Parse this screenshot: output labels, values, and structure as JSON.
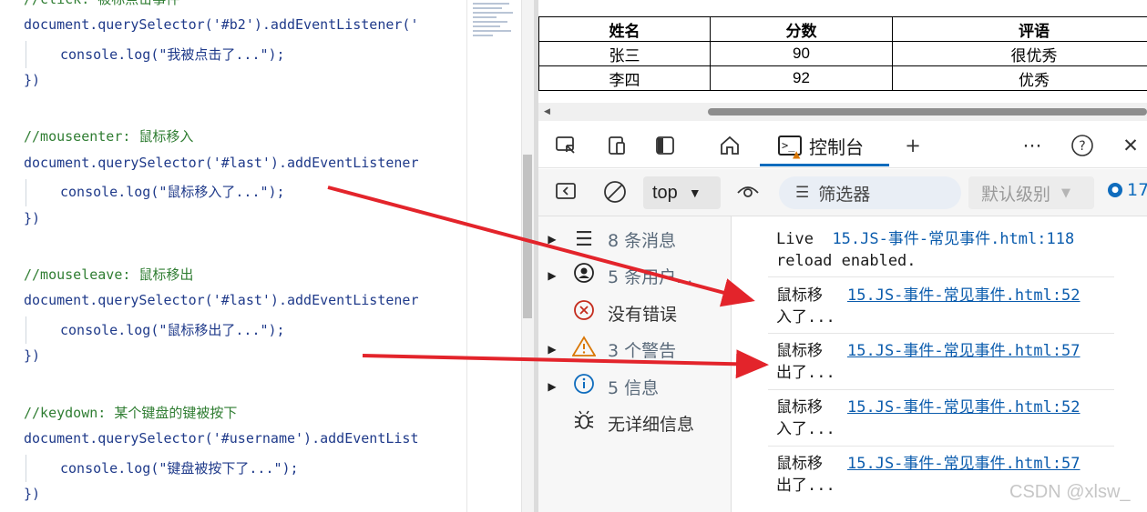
{
  "editor": {
    "lines": [
      {
        "text": "//click: 被标点击事件",
        "kind": "comment"
      },
      {
        "text": "document.querySelector('#b2').addEventListener('",
        "kind": "code"
      },
      {
        "text": "console.log(\"我被点击了...\");",
        "kind": "indent"
      },
      {
        "text": "})",
        "kind": "brace"
      },
      {
        "text": "//mouseenter: 鼠标移入",
        "kind": "comment"
      },
      {
        "text": "document.querySelector('#last').addEventListener",
        "kind": "code"
      },
      {
        "text": "console.log(\"鼠标移入了...\");",
        "kind": "indent"
      },
      {
        "text": "})",
        "kind": "brace"
      },
      {
        "text": "//mouseleave: 鼠标移出",
        "kind": "comment"
      },
      {
        "text": "document.querySelector('#last').addEventListener",
        "kind": "code"
      },
      {
        "text": "console.log(\"鼠标移出了...\");",
        "kind": "indent"
      },
      {
        "text": "})",
        "kind": "brace"
      },
      {
        "text": "//keydown: 某个键盘的键被按下",
        "kind": "comment"
      },
      {
        "text": "document.querySelector('#username').addEventList",
        "kind": "code"
      },
      {
        "text": "console.log(\"键盘被按下了...\");",
        "kind": "indent"
      },
      {
        "text": "})",
        "kind": "brace"
      }
    ]
  },
  "table": {
    "headers": [
      "姓名",
      "分数",
      "评语"
    ],
    "rows": [
      [
        "张三",
        "90",
        "很优秀"
      ],
      [
        "李四",
        "92",
        "优秀"
      ]
    ]
  },
  "devtools": {
    "console_tab": "控制台",
    "context": "top",
    "filter_placeholder": "筛选器",
    "level": "默认级别",
    "issue_count": "17",
    "sidebar": [
      {
        "label": "8 条消息",
        "icon": "list-icon",
        "expandable": true
      },
      {
        "label": "5 条用户...",
        "icon": "user-icon",
        "expandable": true
      },
      {
        "label": "没有错误",
        "icon": "error-icon",
        "expandable": false
      },
      {
        "label": "3 个警告",
        "icon": "warning-icon",
        "expandable": true
      },
      {
        "label": "5 信息",
        "icon": "info-icon",
        "expandable": true
      },
      {
        "label": "无详细信息",
        "icon": "bug-icon",
        "expandable": false
      }
    ],
    "messages": {
      "live_text": "Live",
      "live_source": "15.JS-事件-常见事件.html:118",
      "live_text2": "reload enabled.",
      "items": [
        {
          "line1": "鼠标移",
          "line2": "入了...",
          "source": "15.JS-事件-常见事件.html:52"
        },
        {
          "line1": "鼠标移",
          "line2": "出了...",
          "source": "15.JS-事件-常见事件.html:57"
        },
        {
          "line1": "鼠标移",
          "line2": "入了...",
          "source": "15.JS-事件-常见事件.html:52"
        },
        {
          "line1": "鼠标移",
          "line2": "出了...",
          "source": "15.JS-事件-常见事件.html:57"
        }
      ]
    }
  },
  "watermark": "CSDN @xlsw_",
  "colors": {
    "arrow": "#e3242b",
    "accent": "#0f6cbd",
    "link": "#0b5cad"
  }
}
